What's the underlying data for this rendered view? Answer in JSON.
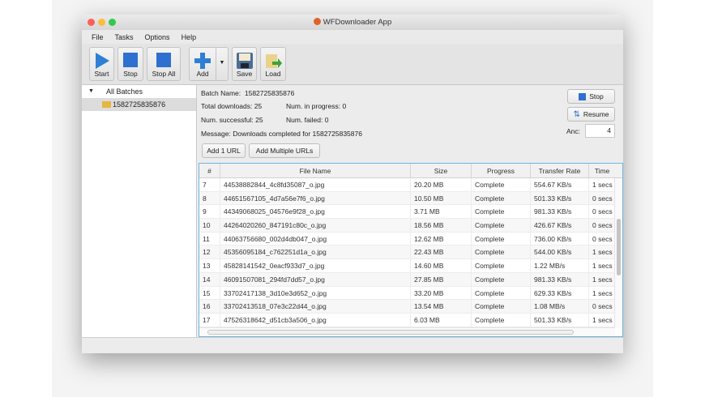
{
  "window": {
    "title": "WFDownloader App"
  },
  "menu": [
    "File",
    "Tasks",
    "Options",
    "Help"
  ],
  "toolbar": {
    "start": "Start",
    "stop": "Stop",
    "stop_all": "Stop All",
    "add": "Add",
    "save": "Save",
    "load": "Load"
  },
  "sidebar": {
    "root": "All Batches",
    "batch": "1582725835876"
  },
  "details": {
    "batch_name_label": "Batch Name:",
    "batch_name": "1582725835876",
    "total_label": "Total downloads:",
    "total": "25",
    "in_progress_label": "Num. in progress:",
    "in_progress": "0",
    "successful_label": "Num. successful:",
    "successful": "25",
    "failed_label": "Num. failed:",
    "failed": "0",
    "message_label": "Message:",
    "message": "Downloads completed for 1582725835876",
    "stop": "Stop",
    "resume": "Resume",
    "anc_label": "Anc:",
    "anc_value": "4",
    "add_one": "Add 1 URL",
    "add_multiple": "Add Multiple URLs"
  },
  "table": {
    "columns": [
      "#",
      "File Name",
      "Size",
      "Progress",
      "Transfer Rate",
      "Time"
    ],
    "rows": [
      [
        "7",
        "44538882844_4c8fd35087_o.jpg",
        "20.20 MB",
        "Complete",
        "554.67 KB/s",
        "1 secs"
      ],
      [
        "8",
        "44651567105_4d7a56e7f6_o.jpg",
        "10.50 MB",
        "Complete",
        "501.33 KB/s",
        "0 secs"
      ],
      [
        "9",
        "44349068025_04576e9f28_o.jpg",
        "3.71 MB",
        "Complete",
        "981.33 KB/s",
        "0 secs"
      ],
      [
        "10",
        "44264020260_847191c80c_o.jpg",
        "18.56 MB",
        "Complete",
        "426.67 KB/s",
        "0 secs"
      ],
      [
        "11",
        "44063756680_002d4db047_o.jpg",
        "12.62 MB",
        "Complete",
        "736.00 KB/s",
        "0 secs"
      ],
      [
        "12",
        "45356095184_c762251d1a_o.jpg",
        "22.43 MB",
        "Complete",
        "544.00 KB/s",
        "1 secs"
      ],
      [
        "13",
        "45828141542_0eacf933d7_o.jpg",
        "14.60 MB",
        "Complete",
        "1.22 MB/s",
        "1 secs"
      ],
      [
        "14",
        "46091507081_294fd7dd57_o.jpg",
        "27.85 MB",
        "Complete",
        "981.33 KB/s",
        "1 secs"
      ],
      [
        "15",
        "33702417138_3d10e3d652_o.jpg",
        "33.20 MB",
        "Complete",
        "629.33 KB/s",
        "1 secs"
      ],
      [
        "16",
        "33702413518_07e3c22d44_o.jpg",
        "13.54 MB",
        "Complete",
        "1.08 MB/s",
        "0 secs"
      ],
      [
        "17",
        "47526318642_d51cb3a506_o.jpg",
        "6.03 MB",
        "Complete",
        "501.33 KB/s",
        "1 secs"
      ]
    ]
  }
}
